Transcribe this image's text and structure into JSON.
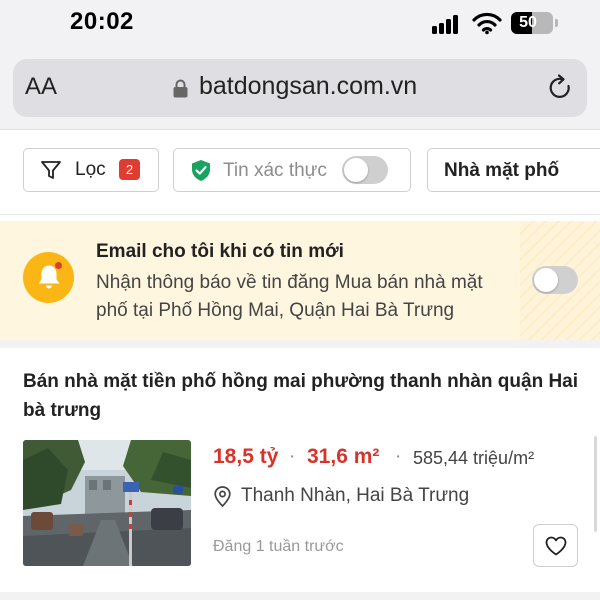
{
  "status_bar": {
    "time": "20:02",
    "battery_level": "50",
    "battery_fraction": 0.5,
    "icons": [
      "signal-icon",
      "wifi-icon",
      "battery-icon"
    ]
  },
  "browser": {
    "text_size_label": "AA",
    "url": "batdongsan.com.vn",
    "icons": [
      "lock-icon",
      "reload-icon"
    ]
  },
  "filters": {
    "filter_label": "Lọc",
    "filter_count": "2",
    "verified_label": "Tin xác thực",
    "verified_enabled": false,
    "property_type_label": "Nhà mặt phố",
    "icons": [
      "funnel-icon",
      "shield-check-icon"
    ]
  },
  "alert": {
    "title": "Email cho tôi khi có tin mới",
    "description": "Nhận thông báo về tin đăng Mua bán nhà mặt phố tại Phố Hồng Mai, Quận Hai Bà Trưng",
    "enabled": false,
    "icon": "bell-icon"
  },
  "listing": {
    "title": "Bán nhà mặt tiền phố hồng mai phường thanh nhàn quận Hai bà trưng",
    "price": "18,5 tỷ",
    "separator": "·",
    "area": "31,6 m²",
    "price_per_m2": "585,44 triệu/m²",
    "location": "Thanh Nhàn, Hai Bà Trưng",
    "posted": "Đăng 1 tuần trước",
    "icons": [
      "location-pin-icon",
      "heart-icon"
    ]
  },
  "colors": {
    "accent_red": "#d7332b",
    "badge_red": "#e03c31",
    "alert_background": "#fff6e0",
    "bell_yellow": "#fab615",
    "verified_green": "#1aa260"
  }
}
